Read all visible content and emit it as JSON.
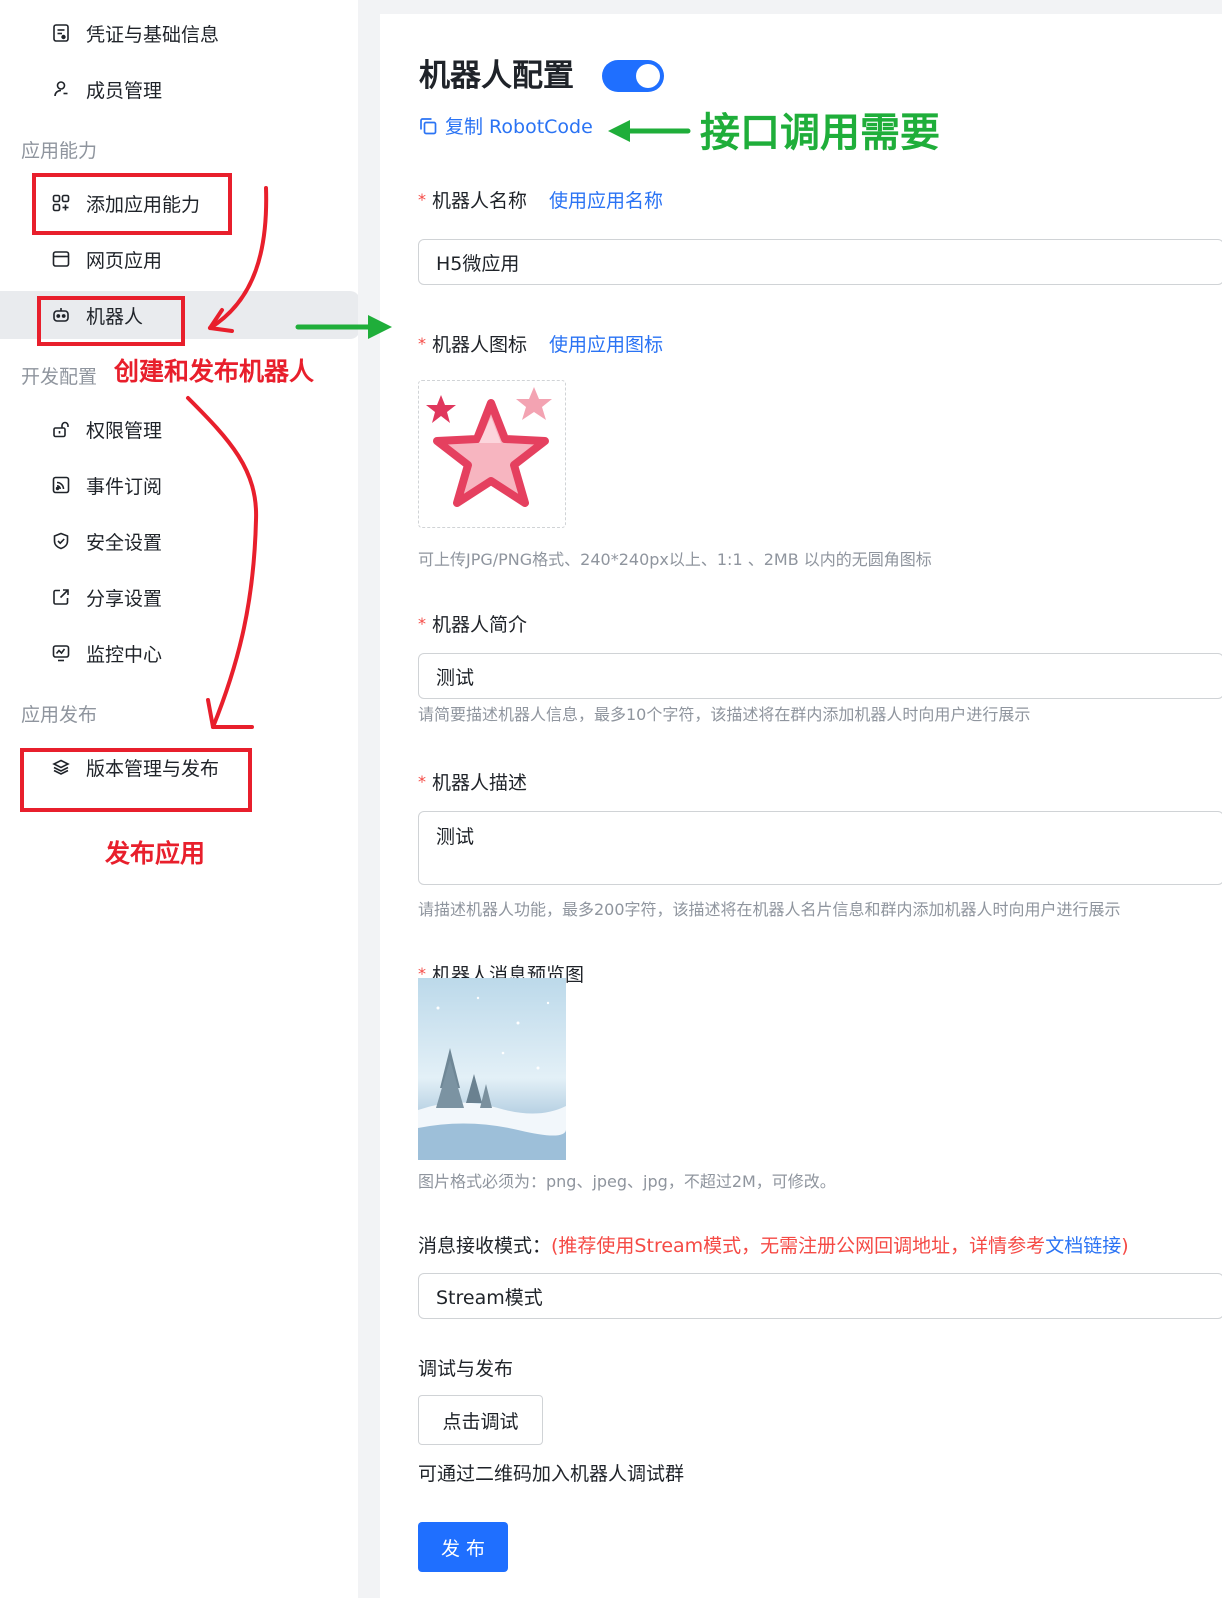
{
  "sidebar": {
    "items": [
      {
        "label": "凭证与基础信息",
        "icon": "credential-icon"
      },
      {
        "label": "成员管理",
        "icon": "member-icon"
      },
      {
        "label": "添加应用能力",
        "icon": "add-app-icon"
      },
      {
        "label": "网页应用",
        "icon": "web-app-icon"
      },
      {
        "label": "机器人",
        "icon": "robot-icon"
      },
      {
        "label": "权限管理",
        "icon": "permission-icon"
      },
      {
        "label": "事件订阅",
        "icon": "event-icon"
      },
      {
        "label": "安全设置",
        "icon": "shield-icon"
      },
      {
        "label": "分享设置",
        "icon": "share-icon"
      },
      {
        "label": "监控中心",
        "icon": "monitor-icon"
      },
      {
        "label": "版本管理与发布",
        "icon": "layers-icon"
      }
    ],
    "sections": {
      "app_capability": "应用能力",
      "dev_config": "开发配置",
      "app_publish": "应用发布"
    },
    "active_item": "机器人"
  },
  "main": {
    "title": "机器人配置",
    "toggle_on": true,
    "copy_label": "复制 RobotCode",
    "name": {
      "label": "机器人名称",
      "link": "使用应用名称",
      "value": "H5微应用"
    },
    "icon": {
      "label": "机器人图标",
      "link": "使用应用图标",
      "hint": "可上传JPG/PNG格式、240*240px以上、1:1 、2MB 以内的无圆角图标"
    },
    "intro": {
      "label": "机器人简介",
      "value": "测试",
      "hint": "请简要描述机器人信息，最多10个字符，该描述将在群内添加机器人时向用户进行展示"
    },
    "desc": {
      "label": "机器人描述",
      "value": "测试",
      "hint": "请描述机器人功能，最多200字符，该描述将在机器人名片信息和群内添加机器人时向用户进行展示"
    },
    "preview": {
      "label": "机器人消息预览图",
      "hint": "图片格式必须为：png、jpeg、jpg，不超过2M，可修改。"
    },
    "mode": {
      "label": "消息接收模式：",
      "note": "(推荐使用Stream模式，无需注册公网回调地址，详情参考",
      "doc_link": "文档链接",
      "note_end": ")",
      "value": "Stream模式"
    },
    "debug": {
      "label": "调试与发布",
      "button": "点击调试",
      "qr_hint": "可通过二维码加入机器人调试群"
    },
    "publish_button": "发布"
  },
  "annotations": {
    "create_robot": "创建和发布机器人",
    "publish_app": "发布应用",
    "api_needed": "接口调用需要"
  },
  "colors": {
    "accent": "#1f6fff",
    "link": "#2a73f4",
    "required": "#f54a45",
    "annotation_red": "#e81f2c",
    "annotation_green": "#1fae3a"
  }
}
